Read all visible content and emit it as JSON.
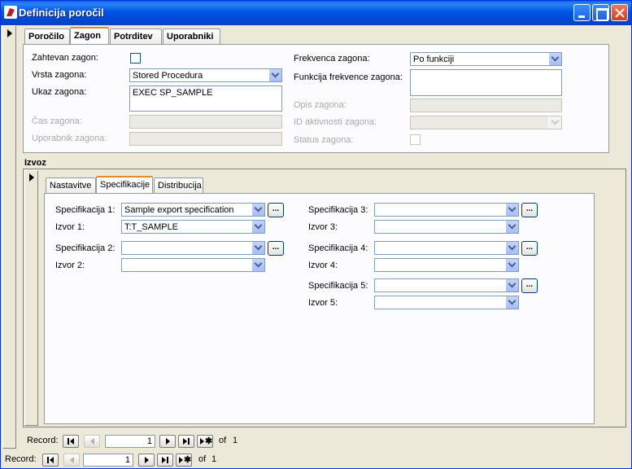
{
  "window": {
    "title": "Definicija poročil"
  },
  "main_tabs": [
    {
      "label": "Poročilo"
    },
    {
      "label": "Zagon"
    },
    {
      "label": "Potrditev"
    },
    {
      "label": "Uporabniki"
    }
  ],
  "zagon": {
    "zahtevan_zagon": {
      "label": "Zahtevan zagon:",
      "checked": false
    },
    "vrsta_zagona": {
      "label": "Vrsta zagona:",
      "value": "Stored Procedura"
    },
    "ukaz_zagona": {
      "label": "Ukaz zagona:",
      "value": "EXEC SP_SAMPLE"
    },
    "cas_zagona": {
      "label": "Čas zagona:",
      "value": ""
    },
    "uporabnik_zagona": {
      "label": "Uporabnik zagona:",
      "value": ""
    },
    "frekvenca_zagona": {
      "label": "Frekvenca zagona:",
      "value": "Po funkciji"
    },
    "funkcija_frekvence": {
      "label": "Funkcija frekvence zagona:",
      "value": ""
    },
    "opis_zagona": {
      "label": "Opis zagona:",
      "value": ""
    },
    "id_aktivnosti": {
      "label": "ID aktivnosti zagona:",
      "value": ""
    },
    "status_zagona": {
      "label": "Status zagona:",
      "checked": false
    }
  },
  "izvoz": {
    "label": "Izvoz",
    "tabs": [
      {
        "label": "Nastavitve"
      },
      {
        "label": "Specifikacije"
      },
      {
        "label": "Distribucija"
      }
    ],
    "spec": [
      {
        "spec_label": "Specifikacija 1:",
        "spec_value": "Sample export specification",
        "izvor_label": "Izvor 1:",
        "izvor_value": "T:T_SAMPLE"
      },
      {
        "spec_label": "Specifikacija 2:",
        "spec_value": "",
        "izvor_label": "Izvor 2:",
        "izvor_value": ""
      },
      {
        "spec_label": "Specifikacija 3:",
        "spec_value": "",
        "izvor_label": "Izvor 3:",
        "izvor_value": ""
      },
      {
        "spec_label": "Specifikacija 4:",
        "spec_value": "",
        "izvor_label": "Izvor 4:",
        "izvor_value": ""
      },
      {
        "spec_label": "Specifikacija 5:",
        "spec_value": "",
        "izvor_label": "Izvor 5:",
        "izvor_value": ""
      }
    ],
    "ellipsis": "...",
    "nav": {
      "label": "Record:",
      "current": "1",
      "of": "of",
      "total": "1"
    }
  },
  "nav": {
    "label": "Record:",
    "current": "1",
    "of": "of",
    "total": "1"
  }
}
